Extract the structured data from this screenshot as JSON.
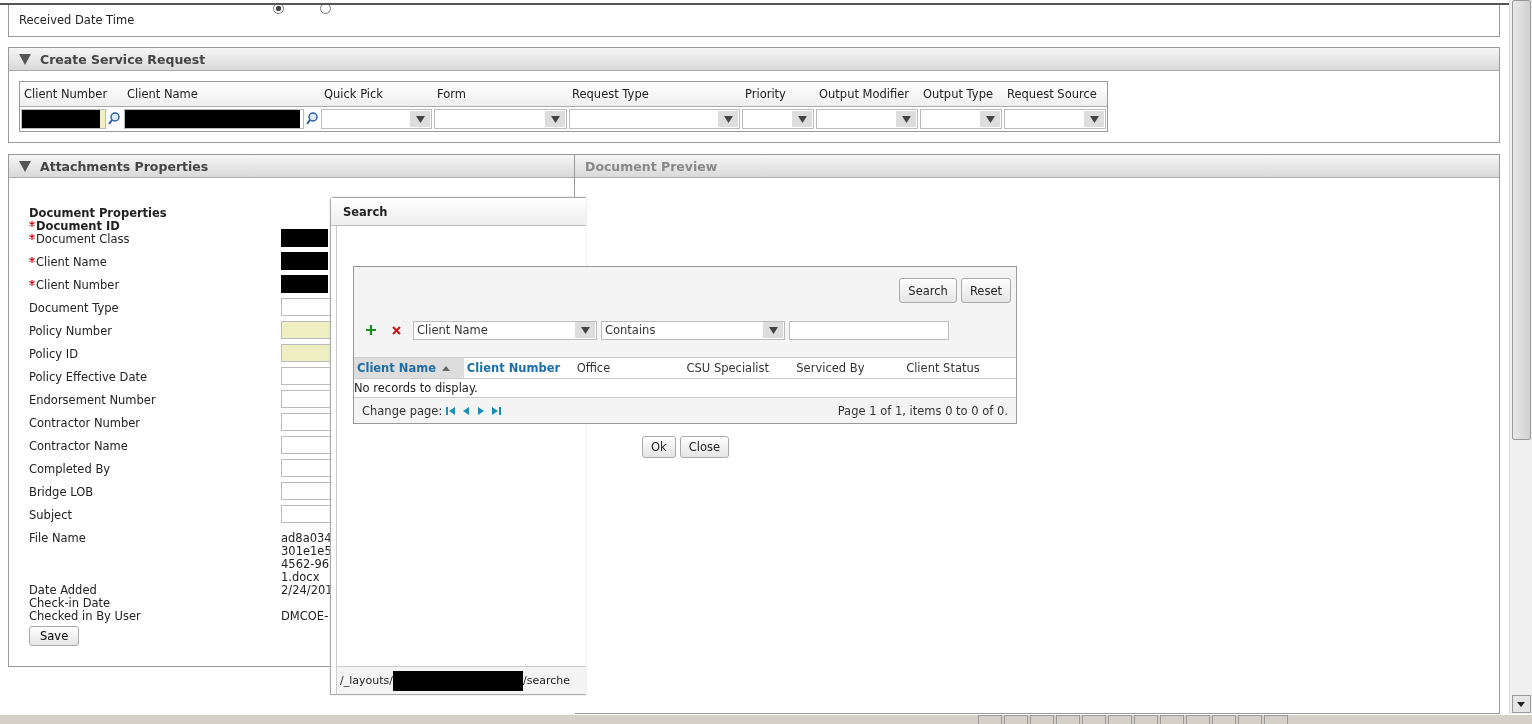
{
  "top_section": {
    "radios": [
      {
        "selected": true
      },
      {
        "selected": false
      }
    ],
    "label": "Received Date Time"
  },
  "service_request": {
    "title": "Create Service Request",
    "expanded": true,
    "columns": [
      {
        "label": "Client Number",
        "kind": "lookup",
        "highlighted": true
      },
      {
        "label": "Client Name",
        "kind": "lookup",
        "highlighted": false
      },
      {
        "label": "Quick Pick",
        "kind": "dropdown"
      },
      {
        "label": "Form",
        "kind": "dropdown"
      },
      {
        "label": "Request Type",
        "kind": "dropdown"
      },
      {
        "label": "Priority",
        "kind": "dropdown"
      },
      {
        "label": "Output Modifier",
        "kind": "dropdown"
      },
      {
        "label": "Output Type",
        "kind": "dropdown"
      },
      {
        "label": "Request Source",
        "kind": "dropdown"
      }
    ]
  },
  "attachments": {
    "title": "Attachments Properties",
    "expanded": true,
    "headings": [
      {
        "text": "Document Properties",
        "required": false
      },
      {
        "text": "Document ID",
        "required": true
      }
    ],
    "fields": [
      {
        "label": "Document Class",
        "required": true,
        "kind": "redacted"
      },
      {
        "label": "Client Name",
        "required": true,
        "kind": "redacted"
      },
      {
        "label": "Client Number",
        "required": true,
        "kind": "redacted"
      },
      {
        "label": "Document Type",
        "required": false,
        "kind": "input",
        "highlighted": false
      },
      {
        "label": "Policy Number",
        "required": false,
        "kind": "input",
        "highlighted": true
      },
      {
        "label": "Policy ID",
        "required": false,
        "kind": "input",
        "highlighted": true
      },
      {
        "label": "Policy Effective Date",
        "required": false,
        "kind": "input",
        "highlighted": false
      },
      {
        "label": "Endorsement Number",
        "required": false,
        "kind": "input",
        "highlighted": false
      },
      {
        "label": "Contractor Number",
        "required": false,
        "kind": "input",
        "highlighted": false
      },
      {
        "label": "Contractor Name",
        "required": false,
        "kind": "input",
        "highlighted": false
      },
      {
        "label": "Completed By",
        "required": false,
        "kind": "input",
        "highlighted": false
      },
      {
        "label": "Bridge LOB",
        "required": false,
        "kind": "input",
        "highlighted": false
      },
      {
        "label": "Subject",
        "required": false,
        "kind": "input",
        "highlighted": false
      },
      {
        "label": "File Name",
        "required": false,
        "kind": "text",
        "lines": [
          "ad8a034",
          "301e1e5",
          "4562-96",
          "1.docx"
        ]
      },
      {
        "label": "Date Added",
        "required": false,
        "kind": "text",
        "lines": [
          "2/24/201"
        ]
      },
      {
        "label": "Check-in Date",
        "required": false,
        "kind": "text"
      },
      {
        "label": "Checked in By User",
        "required": false,
        "kind": "text",
        "lines": [
          "DMCOE-"
        ]
      }
    ],
    "save_button": "Save"
  },
  "document_preview": {
    "title": "Document Preview"
  },
  "search_dialog": {
    "title": "Search",
    "buttons": [
      "Search",
      "Reset"
    ],
    "filter": {
      "field": "Client Name",
      "operator": "Contains"
    },
    "columns": [
      {
        "label": "Client Name",
        "link": true,
        "sorted": true
      },
      {
        "label": "Client Number",
        "link": true,
        "sorted": false
      },
      {
        "label": "Office",
        "link": false,
        "sorted": false
      },
      {
        "label": "CSU Specialist",
        "link": false,
        "sorted": false
      },
      {
        "label": "Serviced By",
        "link": false,
        "sorted": false
      },
      {
        "label": "Client Status",
        "link": false,
        "sorted": false
      }
    ],
    "empty_message": "No records to display.",
    "pager_label": "Change page:",
    "page_info": "Page 1 of 1, items 0 to 0 of 0.",
    "footer_buttons": [
      "Ok",
      "Close"
    ],
    "url_start": "/_layouts/",
    "url_end": "/searche"
  }
}
